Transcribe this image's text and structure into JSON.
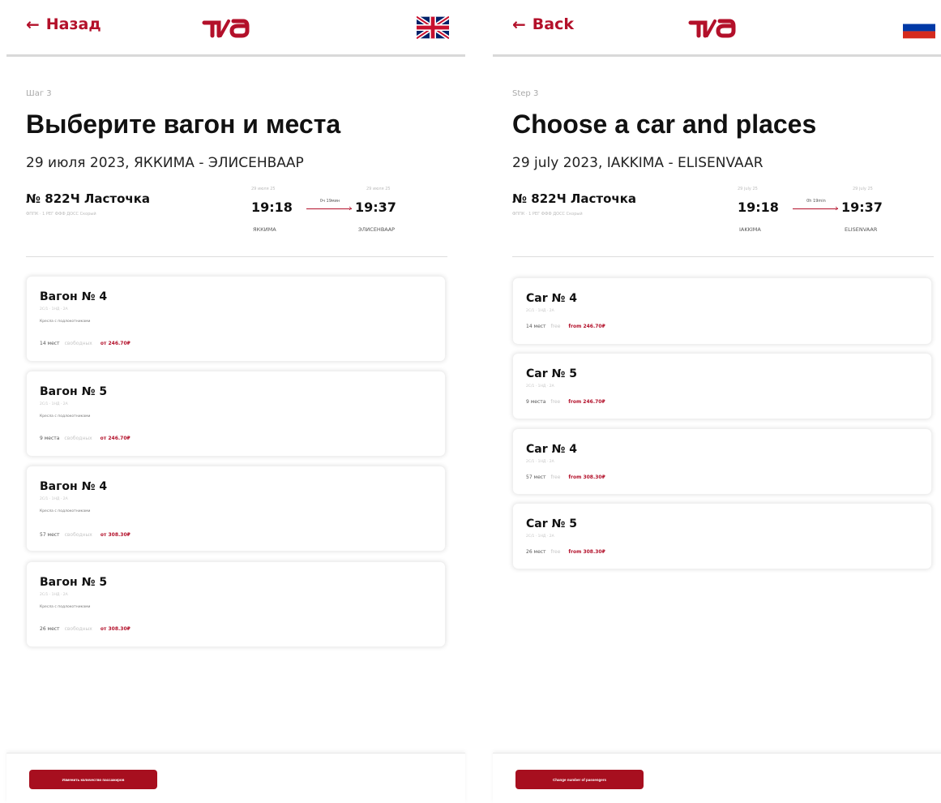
{
  "ru": {
    "back_label": "Назад",
    "logo_text": "РЖД",
    "flag_icon": "uk-flag-icon",
    "step": "Шаг 3",
    "title": "Выберите вагон и места",
    "subtitle": "29 июля 2023, ЯККИМА - ЭЛИСЕНВААР",
    "train": {
      "name": "№ 822Ч Ласточка",
      "sub": "ФППК · 1 РЕГ ФФФ ДОСС Скорый",
      "dep_date": "29 июля 25",
      "arr_date": "29 июля 25",
      "dep_time": "19:18",
      "arr_time": "19:37",
      "duration": "0ч 19мин",
      "dep_station": "ЯККИМА",
      "arr_station": "ЭЛИСЕНВААР"
    },
    "cars": [
      {
        "title": "Вагон № 4",
        "code": "2С/1 · 1НД · 2А",
        "type": "Кресла с подлокотниками",
        "seats": "14 мест",
        "free": "свободных",
        "price": "от 246.70₽"
      },
      {
        "title": "Вагон № 5",
        "code": "2С/1 · 1НД · 2А",
        "type": "Кресла с подлокотниками",
        "seats": "9 места",
        "free": "свободных",
        "price": "от 246.70₽"
      },
      {
        "title": "Вагон № 4",
        "code": "2С/1 · 1НД · 2А",
        "type": "Кресла с подлокотниками",
        "seats": "57 мест",
        "free": "свободных",
        "price": "от 308.30₽"
      },
      {
        "title": "Вагон № 5",
        "code": "2С/1 · 1НД · 2А",
        "type": "Кресла с подлокотниками",
        "seats": "26 мест",
        "free": "свободных",
        "price": "от 308.30₽"
      }
    ],
    "change_button": "Изменить количество пассажиров"
  },
  "en": {
    "back_label": "Back",
    "logo_text": "RZD",
    "flag_icon": "russia-flag-icon",
    "step": "Step 3",
    "title": "Choose a car and places",
    "subtitle": "29 july 2023, IAKKIMA - ELISENVAAR",
    "train": {
      "name": "№ 822Ч Ласточка",
      "sub": "ФППК · 1 РЕГ ФФФ ДОСС Скорый",
      "dep_date": "29 july 25",
      "arr_date": "29 july 25",
      "dep_time": "19:18",
      "arr_time": "19:37",
      "duration": "0h 19min",
      "dep_station": "IAKKIMA",
      "arr_station": "ELISENVAAR"
    },
    "cars": [
      {
        "title": "Car № 4",
        "code": "2С/1 · 1НД · 2А",
        "seats": "14 мест",
        "free": "free",
        "price": "from 246.70₽"
      },
      {
        "title": "Car № 5",
        "code": "2С/1 · 1НД · 2А",
        "seats": "9 места",
        "free": "free",
        "price": "from 246.70₽"
      },
      {
        "title": "Car № 4",
        "code": "2С/1 · 1НД · 2А",
        "seats": "57 мест",
        "free": "free",
        "price": "from 308.30₽"
      },
      {
        "title": "Car № 5",
        "code": "2С/1 · 1НД · 2А",
        "seats": "26 мест",
        "free": "free",
        "price": "from 308.30₽"
      }
    ],
    "change_button": "Change number of passengers"
  },
  "colors": {
    "brand_red": "#b3102a",
    "button_red": "#a70f1f"
  }
}
